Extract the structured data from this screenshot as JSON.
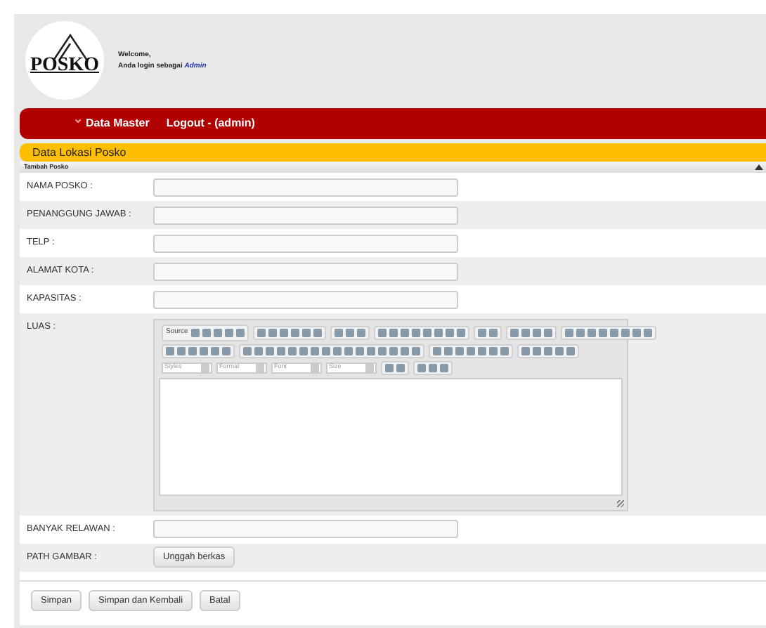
{
  "header": {
    "logo_text": "POSKO",
    "welcome": "Welcome,",
    "login_text": "Anda login sebagai",
    "user": "Admin"
  },
  "nav": [
    {
      "label": "Data Master",
      "dropdown": true
    },
    {
      "label": "Logout - (admin)",
      "dropdown": false
    }
  ],
  "page_title": "Data Lokasi Posko",
  "form": {
    "title": "Tambah Posko",
    "fields": [
      {
        "label": "NAMA POSKO :",
        "kind": "text"
      },
      {
        "label": "PENANGGUNG JAWAB :",
        "kind": "text"
      },
      {
        "label": "TELP :",
        "kind": "text"
      },
      {
        "label": "ALAMAT KOTA :",
        "kind": "text"
      },
      {
        "label": "KAPASITAS :",
        "kind": "text"
      },
      {
        "label": "LUAS :",
        "kind": "editor",
        "source_label": "Source",
        "dropdowns": [
          "Styles",
          "Format",
          "Font",
          "Size"
        ]
      },
      {
        "label": "BANYAK RELAWAN :",
        "kind": "text"
      },
      {
        "label": "PATH GAMBAR :",
        "kind": "upload",
        "button": "Unggah berkas"
      }
    ],
    "buttons": [
      "Simpan",
      "Simpan dan Kembali",
      "Batal"
    ]
  }
}
